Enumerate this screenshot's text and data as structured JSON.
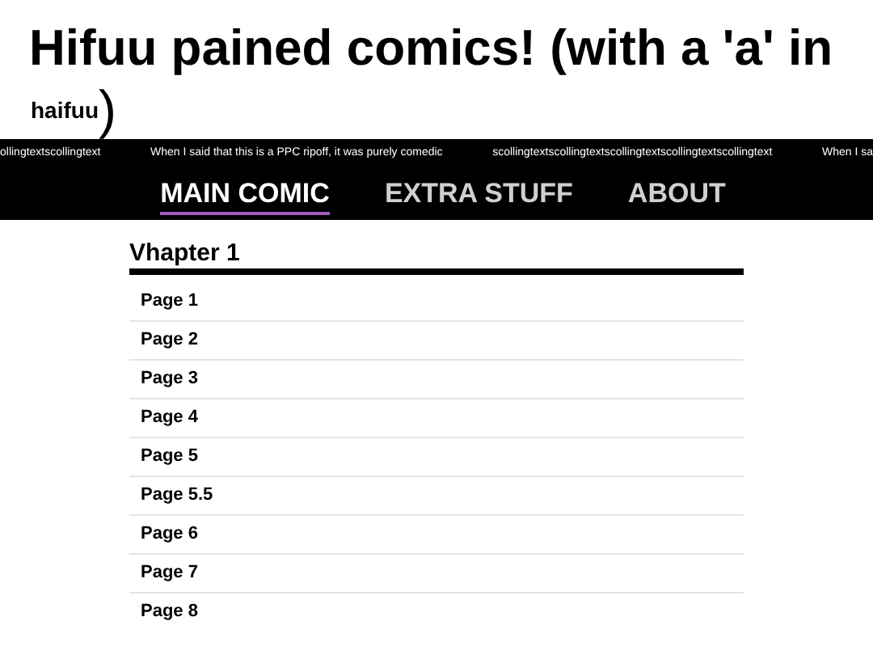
{
  "header": {
    "title": "Hifuu pained comics! (with a 'a' in",
    "title_small": "haifuu",
    "title_end": ")"
  },
  "marquee": [
    "ollingtextscollingtext",
    "When I said that this is a PPC ripoff, it was purely comedic",
    "scollingtextscollingtextscollingtextscollingtextscollingtext",
    "When I sa"
  ],
  "nav": [
    {
      "label": "MAIN COMIC",
      "selected": true
    },
    {
      "label": "EXTRA STUFF",
      "selected": false
    },
    {
      "label": "ABOUT",
      "selected": false
    }
  ],
  "chapter": {
    "title": "Vhapter 1",
    "pages": [
      "Page 1",
      "Page 2",
      "Page 3",
      "Page 4",
      "Page 5",
      "Page 5.5",
      "Page 6",
      "Page 7",
      "Page 8"
    ]
  }
}
